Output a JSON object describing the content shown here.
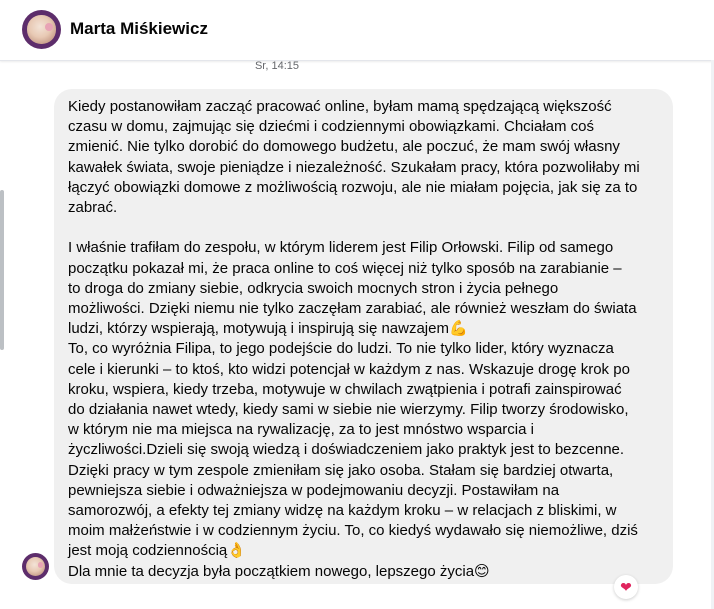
{
  "contact": {
    "name": "Marta Miśkiewicz"
  },
  "timestamp": "Sr, 14:15",
  "message": {
    "text": "Kiedy postanowiłam zacząć pracować online, byłam mamą spędzającą większość\nczasu w domu, zajmując się dziećmi i codziennymi obowiązkami. Chciałam coś\nzmienić. Nie tylko dorobić do domowego budżetu, ale poczuć, że mam swój własny\nkawałek świata, swoje pieniądze i niezależność. Szukałam pracy, która pozwoliłaby mi\nłączyć obowiązki domowe z możliwością rozwoju, ale nie miałam pojęcia, jak się za to\nzabrać.\n\nI właśnie trafiłam do zespołu, w którym liderem jest Filip Orłowski. Filip od samego\npoczątku pokazał mi, że praca online to coś więcej niż tylko sposób na zarabianie –\nto droga do zmiany siebie, odkrycia swoich mocnych stron i życia pełnego\nmożliwości. Dzięki niemu nie tylko zaczęłam zarabiać, ale również weszłam do świata\nludzi, którzy wspierają, motywują i inspirują się nawzajem💪\nTo, co wyróżnia Filipa, to jego podejście do ludzi. To nie tylko lider, który wyznacza\ncele i kierunki – to ktoś, kto widzi potencjał w każdym z nas. Wskazuje drogę krok po\nkroku, wspiera, kiedy trzeba, motywuje w chwilach zwątpienia i potrafi zainspirować\ndo działania nawet wtedy, kiedy sami w siebie nie wierzymy. Filip tworzy środowisko,\nw którym nie ma miejsca na rywalizację, za to jest mnóstwo wsparcia i\nżyczliwości.Dzieli się swoją wiedzą i doświadczeniem jako praktyk jest to bezcenne.\nDzięki pracy w tym zespole zmieniłam się jako osoba. Stałam się bardziej otwarta,\npewniejsza siebie i odważniejsza w podejmowaniu decyzji. Postawiłam na\nsamorozwój, a efekty tej zmiany widzę na każdym kroku – w relacjach z bliskimi, w\nmoim małżeństwie i w codziennym życiu. To, co kiedyś wydawało się niemożliwe, dziś\njest moją codziennością👌\nDla mnie ta decyzja była początkiem nowego, lepszego życia😊",
    "reaction": "❤"
  },
  "icons": {
    "header_avatar": "contact-avatar",
    "message_avatar": "sender-avatar",
    "reaction": "heart-reaction-icon"
  },
  "colors": {
    "bubble": "#f0f0f0",
    "reaction": "#e0245e",
    "avatar_ring": "#5d2d6b"
  }
}
